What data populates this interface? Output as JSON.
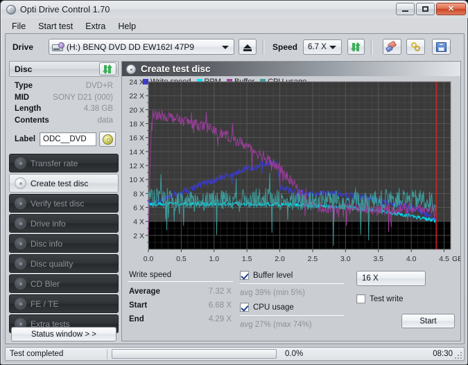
{
  "window": {
    "title": "Opti Drive Control 1.70",
    "icon": "disc-icon",
    "minimize_label": "–",
    "maximize_label": "□",
    "close_label": "✕"
  },
  "menu": {
    "items": [
      {
        "label": "File"
      },
      {
        "label": "Start test"
      },
      {
        "label": "Extra"
      },
      {
        "label": "Help"
      }
    ]
  },
  "toolbar": {
    "drive_label": "Drive",
    "drive_value": "(H:)   BENQ DVD DD EW162I 47P9",
    "eject_name": "eject-button",
    "speed_label": "Speed",
    "speed_value": "6.7 X",
    "refresh_name": "refresh-button",
    "erase_name": "erase-button",
    "tools_name": "tools-button",
    "save_name": "save-button"
  },
  "disc": {
    "header": "Disc",
    "refresh_name": "disc-refresh-button",
    "rows": [
      {
        "key": "Type",
        "value": "DVD+R"
      },
      {
        "key": "MID",
        "value": "SONY D21 (000)"
      },
      {
        "key": "Length",
        "value": "4.38 GB"
      },
      {
        "key": "Contents",
        "value": "data"
      }
    ],
    "label_key": "Label",
    "label_value": "ODC__DVD",
    "label_button": "cd-label-button"
  },
  "sidebar": {
    "items": [
      {
        "label": "Transfer rate",
        "active": false
      },
      {
        "label": "Create test disc",
        "active": true
      },
      {
        "label": "Verify test disc",
        "active": false
      },
      {
        "label": "Drive info",
        "active": false
      },
      {
        "label": "Disc info",
        "active": false
      },
      {
        "label": "Disc quality",
        "active": false
      },
      {
        "label": "CD Bler",
        "active": false
      },
      {
        "label": "FE / TE",
        "active": false
      },
      {
        "label": "Extra tests",
        "active": false
      }
    ],
    "status_window_label": "Status window > >"
  },
  "panel": {
    "title": "Create test disc"
  },
  "stats": {
    "write_speed_header": "Write speed",
    "rows": [
      {
        "key": "Average",
        "value": "7.32 X"
      },
      {
        "key": "Start",
        "value": "6.68 X"
      },
      {
        "key": "End",
        "value": "4.29 X"
      }
    ],
    "buffer_label": "Buffer level",
    "buffer_checked": true,
    "buffer_value": "avg 39% (min 5%)",
    "cpu_label": "CPU usage",
    "cpu_checked": true,
    "cpu_value": "avg 27% (max 74%)",
    "speed_select_value": "16 X",
    "test_write_label": "Test write",
    "test_write_checked": false,
    "start_label": "Start"
  },
  "statusbar": {
    "message": "Test completed",
    "percent": "0.0%",
    "time": "08:30",
    "progress_value": 0
  },
  "chart_data": {
    "type": "line",
    "title": "Create test disc",
    "xlabel": "GB",
    "ylabel": "",
    "xlim": [
      0.0,
      4.6
    ],
    "ylim": [
      0,
      24
    ],
    "grid": true,
    "legend_position": "top-left",
    "x_ticks": [
      "0.0",
      "0.5",
      "1.0",
      "1.5",
      "2.0",
      "2.5",
      "3.0",
      "3.5",
      "4.0",
      "4.5"
    ],
    "x_tick_values": [
      0.0,
      0.5,
      1.0,
      1.5,
      2.0,
      2.5,
      3.0,
      3.5,
      4.0,
      4.5
    ],
    "x_unit_label": "GB",
    "y_ticks": [
      "2 X",
      "4 X",
      "6 X",
      "8 X",
      "10 X",
      "12 X",
      "14 X",
      "16 X",
      "18 X",
      "20 X",
      "22 X",
      "24 X"
    ],
    "y_tick_values": [
      2,
      4,
      6,
      8,
      10,
      12,
      14,
      16,
      18,
      20,
      22,
      24
    ],
    "end_marker_x": 4.38,
    "end_marker_color": "#e02020",
    "plot_bg": "#3a3a3a",
    "plot_bg_low": "#000000",
    "plot_bg_low_below": 4,
    "grid_color": "#5c5c5c",
    "series": [
      {
        "name": "Write speed",
        "color": "#3b3bd6",
        "x": [
          0.0,
          0.05,
          0.1,
          0.15,
          0.2,
          0.25,
          0.3,
          0.4,
          0.5,
          0.6,
          0.7,
          0.8,
          0.9,
          1.0,
          1.1,
          1.2,
          1.3,
          1.4,
          1.5,
          1.6,
          1.7,
          1.8,
          1.85,
          1.9,
          1.95,
          2.0,
          2.1,
          2.2,
          2.3,
          2.4,
          2.5,
          2.6,
          2.7,
          2.8,
          2.9,
          3.0,
          3.1,
          3.2,
          3.3,
          3.4,
          3.5,
          3.6,
          3.7,
          3.8,
          3.9,
          4.0,
          4.1,
          4.2,
          4.3,
          4.38
        ],
        "values": [
          6.68,
          6.6,
          6.7,
          6.9,
          7.1,
          7.3,
          7.5,
          7.9,
          8.2,
          8.6,
          8.9,
          9.3,
          9.6,
          9.9,
          10.3,
          10.6,
          10.9,
          11.2,
          11.5,
          11.8,
          12.1,
          12.4,
          12.5,
          12.5,
          12.4,
          9.0,
          8.6,
          8.3,
          8.2,
          8.0,
          7.9,
          8.0,
          8.1,
          8.0,
          7.9,
          7.8,
          7.6,
          7.4,
          7.6,
          7.2,
          7.0,
          6.8,
          6.6,
          6.4,
          6.2,
          6.0,
          5.6,
          5.2,
          4.8,
          4.29
        ],
        "noise": 0.9
      },
      {
        "name": "RPM",
        "color": "#00e5ff",
        "x": [
          0.0,
          0.2,
          0.4,
          0.6,
          0.8,
          1.0,
          1.2,
          1.4,
          1.6,
          1.8,
          2.0,
          2.2,
          2.4,
          2.6,
          2.8,
          3.0,
          3.2,
          3.4,
          3.6,
          3.8,
          4.0,
          4.2,
          4.38
        ],
        "values": [
          6.5,
          6.5,
          6.5,
          6.5,
          6.5,
          6.5,
          6.5,
          6.5,
          6.5,
          6.5,
          6.4,
          6.4,
          6.3,
          6.2,
          6.1,
          6.0,
          5.8,
          5.6,
          5.4,
          5.1,
          4.8,
          4.4,
          4.1
        ],
        "noise": 0.5
      },
      {
        "name": "Buffer",
        "color": "#9b3d9b",
        "x": [
          0.0,
          0.05,
          0.1,
          0.2,
          0.3,
          0.4,
          0.5,
          0.6,
          0.7,
          0.8,
          0.9,
          1.0,
          1.1,
          1.2,
          1.3,
          1.4,
          1.5,
          1.6,
          1.7,
          1.8,
          1.9,
          2.0,
          2.1,
          2.2,
          2.3,
          2.4,
          2.5,
          2.6,
          2.7,
          2.8,
          3.0,
          3.2,
          3.4,
          3.6,
          3.8,
          4.0,
          4.2,
          4.38
        ],
        "values": [
          2.0,
          19.3,
          19.3,
          19.2,
          19.0,
          18.8,
          18.5,
          18.3,
          18.0,
          17.7,
          17.4,
          17.0,
          16.6,
          16.2,
          15.8,
          15.3,
          14.8,
          14.2,
          13.6,
          13.0,
          12.3,
          11.5,
          10.5,
          9.5,
          8.3,
          7.2,
          6.4,
          6.0,
          5.9,
          5.8,
          5.8,
          5.8,
          5.8,
          5.8,
          5.8,
          5.8,
          5.8,
          5.8
        ],
        "noise": 1.4
      },
      {
        "name": "CPU usage",
        "color": "#3d9b9b",
        "x": [
          0.0,
          0.1,
          0.2,
          0.3,
          0.4,
          0.5,
          0.6,
          0.7,
          0.8,
          0.9,
          1.0,
          1.2,
          1.4,
          1.6,
          1.8,
          2.0,
          2.2,
          2.4,
          2.6,
          2.8,
          3.0,
          3.2,
          3.4,
          3.6,
          3.8,
          4.0,
          4.1,
          4.2,
          4.3,
          4.38
        ],
        "values": [
          7.0,
          7.5,
          7.2,
          7.0,
          6.8,
          6.8,
          6.8,
          6.9,
          7.0,
          7.0,
          7.0,
          7.1,
          7.2,
          7.3,
          7.4,
          7.0,
          6.8,
          6.8,
          7.0,
          7.2,
          7.0,
          6.8,
          7.0,
          7.2,
          7.4,
          7.0,
          7.2,
          7.0,
          6.8,
          6.6
        ],
        "noise": 2.6
      }
    ],
    "legend": [
      {
        "label": "Write speed",
        "color": "#3b3bd6"
      },
      {
        "label": "RPM",
        "color": "#00e5ff"
      },
      {
        "label": "Buffer",
        "color": "#9b3d9b"
      },
      {
        "label": "CPU usage",
        "color": "#3d9b9b"
      }
    ]
  }
}
